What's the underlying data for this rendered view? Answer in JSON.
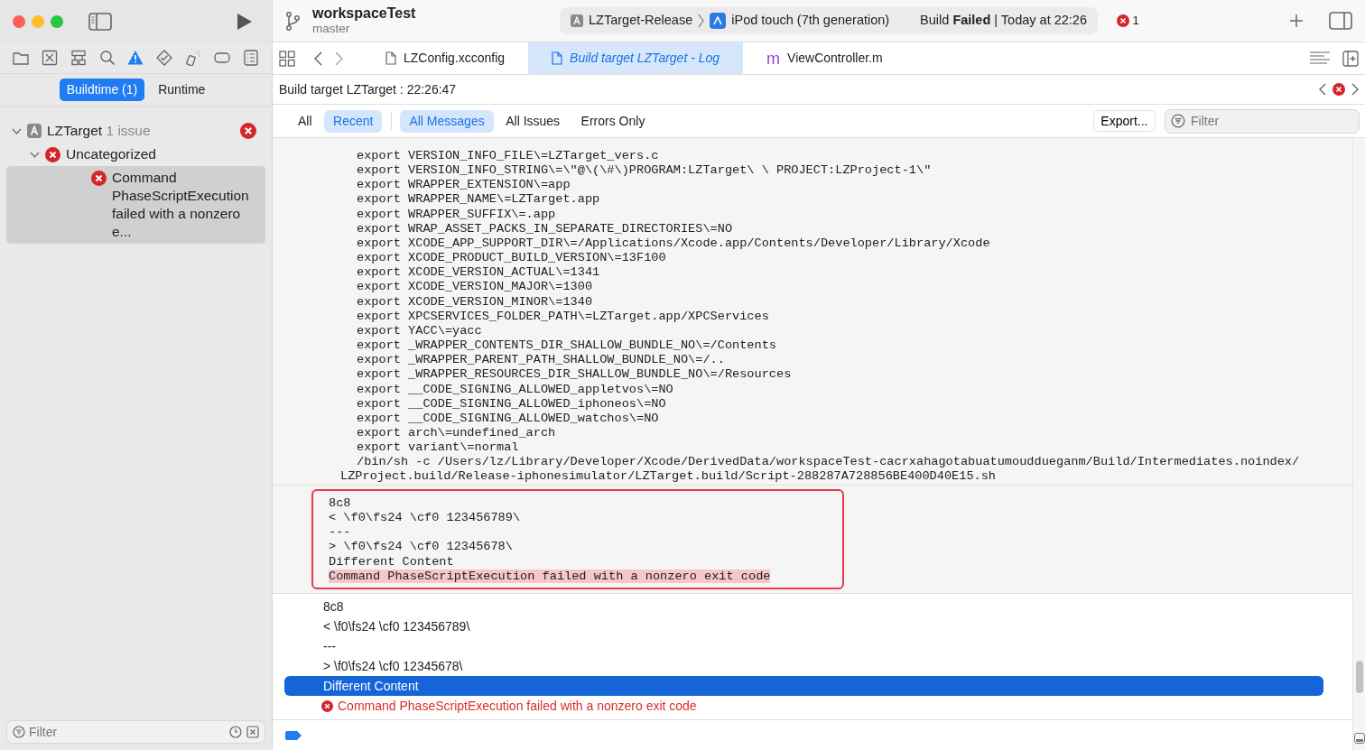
{
  "window": {
    "project": "workspaceTest",
    "branch": "master"
  },
  "scheme": {
    "target": "LZTarget-Release",
    "device": "iPod touch (7th generation)",
    "status": "Build **Failed** | Today at 22:26",
    "error_count": "1"
  },
  "sidebar": {
    "tools": [
      {
        "selected": false
      },
      {
        "selected": false
      },
      {
        "selected": false
      },
      {
        "selected": false
      },
      {
        "selected": true
      },
      {
        "selected": false
      },
      {
        "selected": false
      },
      {
        "selected": false
      },
      {
        "selected": false
      }
    ],
    "segments": [
      {
        "label": "Buildtime (1)",
        "selected": true
      },
      {
        "label": "Runtime",
        "selected": false
      }
    ],
    "tree": [
      {
        "label": "LZTarget",
        "detail": "1 issue",
        "kind": "target",
        "expanded": true,
        "selected": false,
        "children": [
          {
            "label": "Uncategorized",
            "kind": "error",
            "expanded": true,
            "selected": false,
            "children": [
              {
                "label": "Command PhaseScriptExecution failed with a nonzero e...",
                "kind": "error",
                "selected": true
              }
            ]
          }
        ]
      }
    ],
    "filter": {
      "placeholder": "Filter"
    }
  },
  "tabs": [
    {
      "label": "LZConfig.xcconfig",
      "kind": "doc",
      "selected": false
    },
    {
      "label": "Build target LZTarget - Log",
      "kind": "doc",
      "selected": true
    },
    {
      "label": "ViewController.m",
      "kind": "letter",
      "letter": "m",
      "selected": false
    }
  ],
  "log_header": {
    "title": "Build target LZTarget : 22:26:47"
  },
  "filters": {
    "scope": [
      {
        "label": "All",
        "selected": false
      },
      {
        "label": "Recent",
        "selected": true
      }
    ],
    "messages": [
      {
        "label": "All Messages",
        "selected": true
      },
      {
        "label": "All Issues",
        "selected": false
      },
      {
        "label": "Errors Only",
        "selected": false
      }
    ],
    "export": "Export...",
    "search_placeholder": "Filter"
  },
  "log_lines": [
    {
      "text": "export VERSION_INFO_FILE\\=LZTarget_vers.c",
      "kind": "line"
    },
    {
      "text": "export VERSION_INFO_STRING\\=\\\"@\\(\\#\\)PROGRAM:LZTarget\\ \\ PROJECT:LZProject-1\\\"",
      "kind": "line"
    },
    {
      "text": "export WRAPPER_EXTENSION\\=app",
      "kind": "line"
    },
    {
      "text": "export WRAPPER_NAME\\=LZTarget.app",
      "kind": "line"
    },
    {
      "text": "export WRAPPER_SUFFIX\\=.app",
      "kind": "line"
    },
    {
      "text": "export WRAP_ASSET_PACKS_IN_SEPARATE_DIRECTORIES\\=NO",
      "kind": "line"
    },
    {
      "text": "export XCODE_APP_SUPPORT_DIR\\=/Applications/Xcode.app/Contents/Developer/Library/Xcode",
      "kind": "line"
    },
    {
      "text": "export XCODE_PRODUCT_BUILD_VERSION\\=13F100",
      "kind": "line"
    },
    {
      "text": "export XCODE_VERSION_ACTUAL\\=1341",
      "kind": "line"
    },
    {
      "text": "export XCODE_VERSION_MAJOR\\=1300",
      "kind": "line"
    },
    {
      "text": "export XCODE_VERSION_MINOR\\=1340",
      "kind": "line"
    },
    {
      "text": "export XPCSERVICES_FOLDER_PATH\\=LZTarget.app/XPCServices",
      "kind": "line"
    },
    {
      "text": "export YACC\\=yacc",
      "kind": "line"
    },
    {
      "text": "export _WRAPPER_CONTENTS_DIR_SHALLOW_BUNDLE_NO\\=/Contents",
      "kind": "line"
    },
    {
      "text": "export _WRAPPER_PARENT_PATH_SHALLOW_BUNDLE_NO\\=/..",
      "kind": "line"
    },
    {
      "text": "export _WRAPPER_RESOURCES_DIR_SHALLOW_BUNDLE_NO\\=/Resources",
      "kind": "line"
    },
    {
      "text": "export __CODE_SIGNING_ALLOWED_appletvos\\=NO",
      "kind": "line"
    },
    {
      "text": "export __CODE_SIGNING_ALLOWED_iphoneos\\=NO",
      "kind": "line"
    },
    {
      "text": "export __CODE_SIGNING_ALLOWED_watchos\\=NO",
      "kind": "line"
    },
    {
      "text": "export arch\\=undefined_arch",
      "kind": "line"
    },
    {
      "text": "export variant\\=normal",
      "kind": "line"
    },
    {
      "text": "/bin/sh -c /Users/lz/Library/Developer/Xcode/DerivedData/workspaceTest-cacrxahagotabuatumouddueganm/Build/Intermediates.noindex/",
      "kind": "line"
    },
    {
      "text": "LZProject.build/Release-iphonesimulator/LZTarget.build/Script-288287A728856BE400D40E15.sh",
      "kind": "continuation"
    }
  ],
  "output_lines": [
    {
      "text": "8c8",
      "highlighted": false
    },
    {
      "text": "< \\f0\\fs24 \\cf0 123456789\\",
      "highlighted": false
    },
    {
      "text": "---",
      "highlighted": false
    },
    {
      "text": "> \\f0\\fs24 \\cf0 12345678\\",
      "highlighted": false
    },
    {
      "text": "Different Content",
      "highlighted": false
    },
    {
      "text": "Command PhaseScriptExecution failed with a nonzero exit code",
      "highlighted": true
    }
  ],
  "messages": [
    {
      "text": "8c8",
      "kind": "plain",
      "selected": false
    },
    {
      "text": "< \\f0\\fs24 \\cf0 123456789\\",
      "kind": "plain",
      "selected": false
    },
    {
      "text": "---",
      "kind": "plain",
      "selected": false
    },
    {
      "text": "> \\f0\\fs24 \\cf0 12345678\\",
      "kind": "plain",
      "selected": false
    },
    {
      "text": "Different Content",
      "kind": "plain",
      "selected": true
    },
    {
      "text": "Command PhaseScriptExecution failed with a nonzero exit code",
      "kind": "error",
      "selected": false
    }
  ]
}
